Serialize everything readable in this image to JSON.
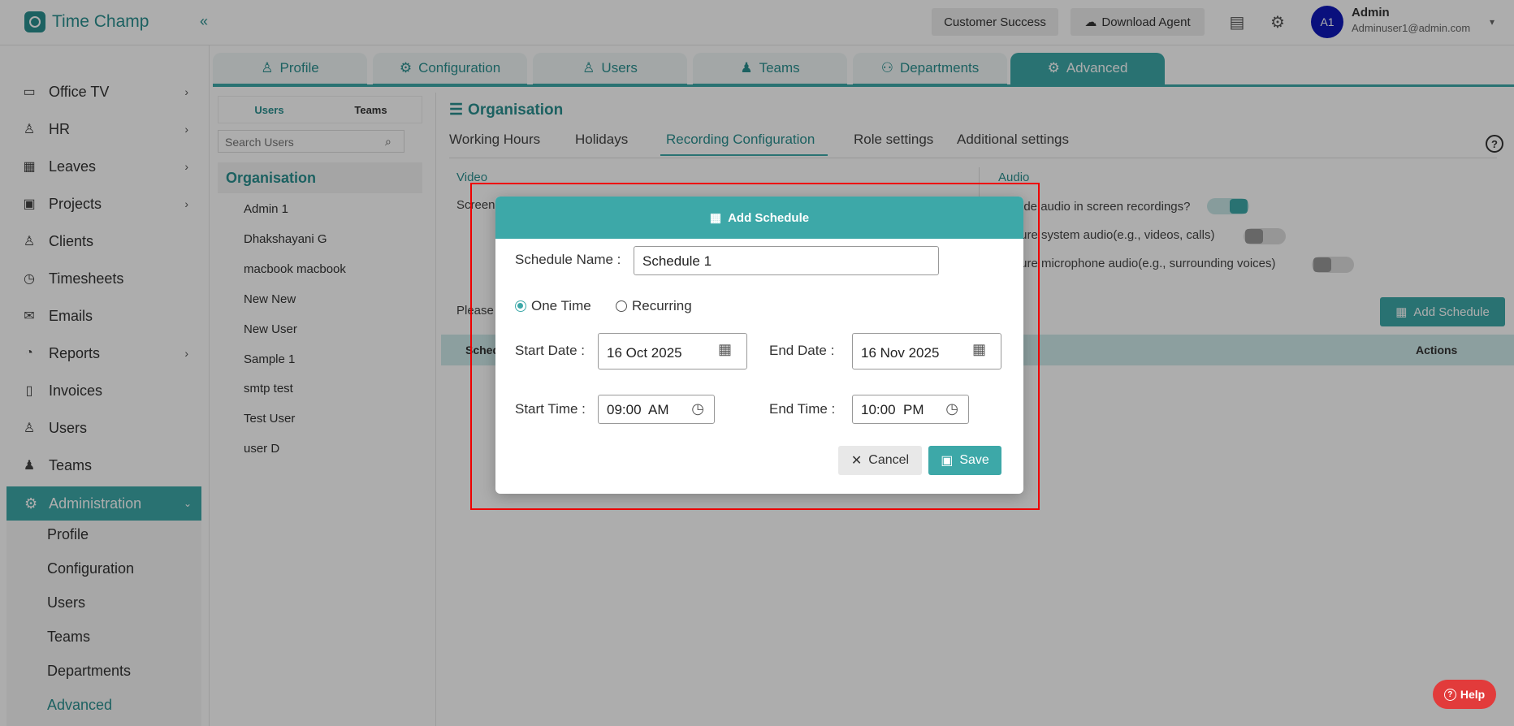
{
  "app": {
    "name": "Time Champ"
  },
  "header": {
    "customer_success": "Customer Success",
    "download_agent": "Download Agent",
    "user_initials": "A1",
    "user_name": "Admin",
    "user_email": "Adminuser1@admin.com"
  },
  "sidebar": {
    "items": [
      {
        "label": "Office TV",
        "icon": "tv-icon"
      },
      {
        "label": "HR",
        "icon": "person-icon"
      },
      {
        "label": "Leaves",
        "icon": "calendar-icon"
      },
      {
        "label": "Projects",
        "icon": "briefcase-icon"
      },
      {
        "label": "Clients",
        "icon": "client-icon"
      },
      {
        "label": "Timesheets",
        "icon": "clock-icon"
      },
      {
        "label": "Emails",
        "icon": "mail-icon"
      },
      {
        "label": "Reports",
        "icon": "pie-chart-icon"
      },
      {
        "label": "Invoices",
        "icon": "invoice-icon"
      },
      {
        "label": "Users",
        "icon": "users-icon"
      },
      {
        "label": "Teams",
        "icon": "teams-icon"
      }
    ],
    "admin_label": "Administration",
    "sub_items": [
      "Profile",
      "Configuration",
      "Users",
      "Teams",
      "Departments",
      "Advanced"
    ]
  },
  "main_tabs": [
    "Profile",
    "Configuration",
    "Users",
    "Teams",
    "Departments",
    "Advanced"
  ],
  "user_panel": {
    "tab_users": "Users",
    "tab_teams": "Teams",
    "search_placeholder": "Search Users",
    "org_header": "Organisation",
    "users": [
      "Admin 1",
      "Dhakshayani G",
      "macbook macbook",
      "New New",
      "New User",
      "Sample 1",
      "smtp test",
      "Test User",
      "user D"
    ]
  },
  "content": {
    "title": "Organisation",
    "subtabs": [
      "Working Hours",
      "Holidays",
      "Recording Configuration",
      "Role settings",
      "Additional settings"
    ],
    "video_label": "Video",
    "screen_label": "Screen",
    "audio_label": "Audio",
    "audio_options": [
      "ude audio in screen recordings?",
      "ture system audio(e.g., videos, calls)",
      "ture microphone audio(e.g., surrounding voices)"
    ],
    "please_label": "Please",
    "add_schedule_button": "Add Schedule",
    "table_col_schedule": "Schedu",
    "table_col_actions": "Actions"
  },
  "modal": {
    "title": "Add Schedule",
    "schedule_name_label": "Schedule Name :",
    "schedule_name_value": "Schedule 1",
    "radio_one_time": "One Time",
    "radio_recurring": "Recurring",
    "start_date_label": "Start Date :",
    "start_date_value": "16 Oct 2025",
    "end_date_label": "End Date :",
    "end_date_value": "16 Nov 2025",
    "start_time_label": "Start Time :",
    "start_time_value": "09:00  AM",
    "end_time_label": "End Time :",
    "end_time_value": "10:00  PM",
    "cancel_label": "Cancel",
    "save_label": "Save"
  },
  "help_button": "Help",
  "colors": {
    "accent": "#3da8a8",
    "highlight": "#e00000",
    "avatar": "#1018b8"
  }
}
